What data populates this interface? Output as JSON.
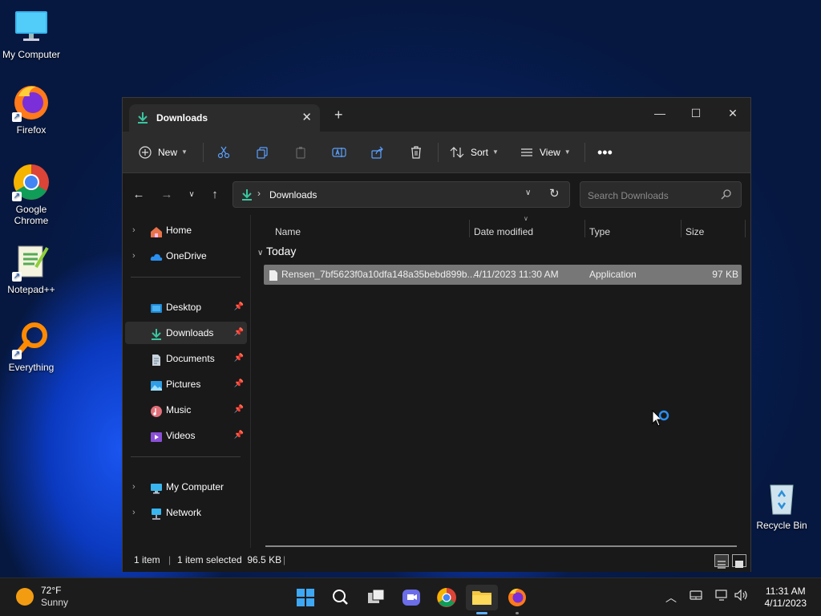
{
  "desktop": {
    "icons": [
      {
        "label": "My Computer"
      },
      {
        "label": "Firefox"
      },
      {
        "label": "Google Chrome"
      },
      {
        "label": "Notepad++"
      },
      {
        "label": "Everything"
      },
      {
        "label": "Recycle Bin"
      }
    ]
  },
  "explorer": {
    "tab_title": "Downloads",
    "toolbar": {
      "new_label": "New",
      "sort_label": "Sort",
      "view_label": "View"
    },
    "address": {
      "path": "Downloads",
      "search_placeholder": "Search Downloads"
    },
    "nav": {
      "items": [
        {
          "label": "Home",
          "icon": "home-icon"
        },
        {
          "label": "OneDrive",
          "icon": "cloud-icon"
        },
        {
          "label": "Desktop",
          "icon": "desktop-icon"
        },
        {
          "label": "Downloads",
          "icon": "download-icon"
        },
        {
          "label": "Documents",
          "icon": "document-icon"
        },
        {
          "label": "Pictures",
          "icon": "pictures-icon"
        },
        {
          "label": "Music",
          "icon": "music-icon"
        },
        {
          "label": "Videos",
          "icon": "videos-icon"
        },
        {
          "label": "My Computer",
          "icon": "computer-icon"
        },
        {
          "label": "Network",
          "icon": "network-icon"
        }
      ]
    },
    "columns": [
      "Name",
      "Date modified",
      "Type",
      "Size"
    ],
    "group_label": "Today",
    "files": [
      {
        "name": "Rensen_7bf5623f0a10dfa148a35bebd899b...",
        "date": "4/11/2023 11:30 AM",
        "type": "Application",
        "size": "97 KB"
      }
    ],
    "status": {
      "count": "1 item",
      "selection": "1 item selected  96.5 KB"
    }
  },
  "taskbar": {
    "weather_temp": "72°F",
    "weather_desc": "Sunny",
    "time": "11:31 AM",
    "date": "4/11/2023"
  }
}
